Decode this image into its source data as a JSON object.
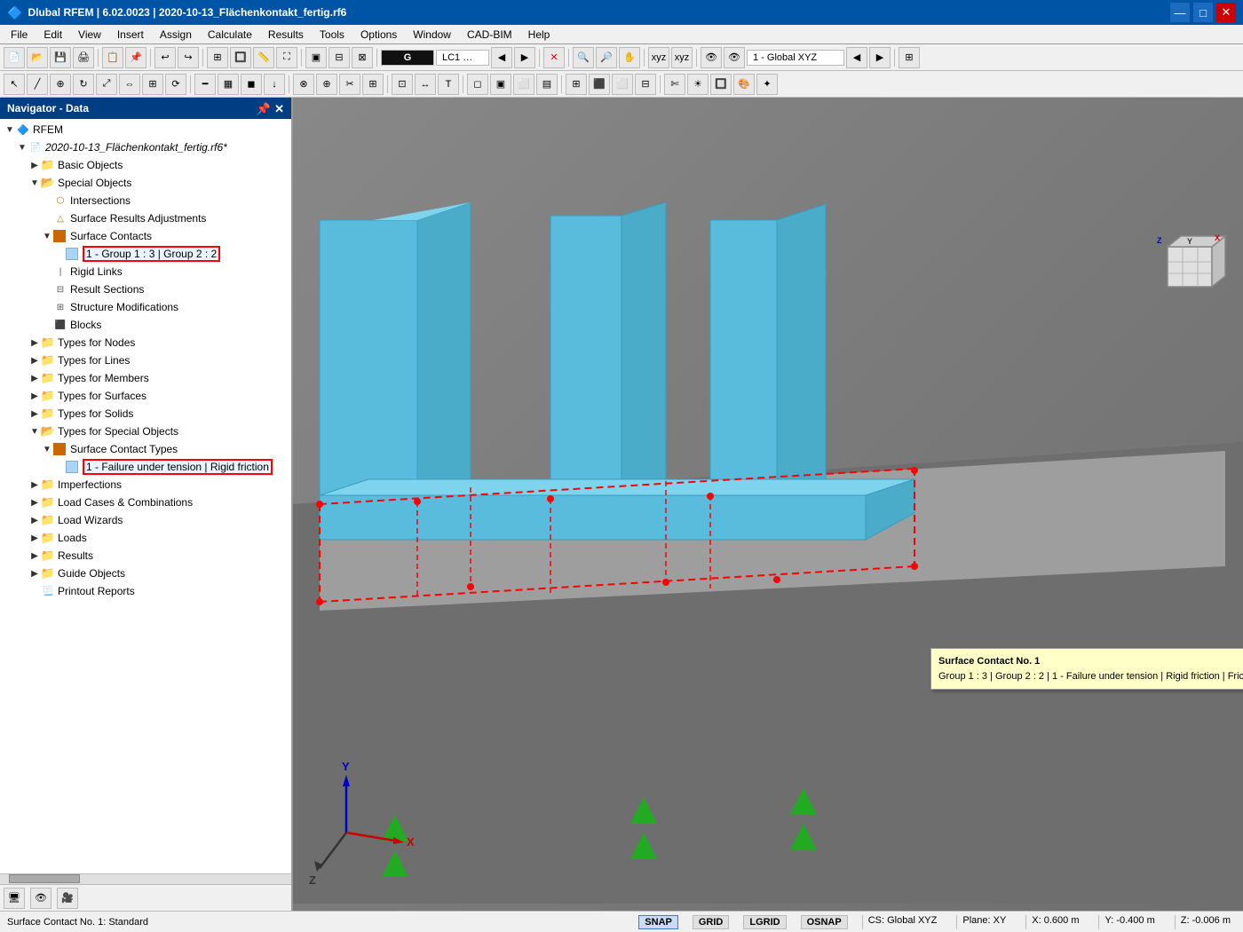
{
  "titlebar": {
    "title": "Dlubal RFEM | 6.02.0023 | 2020-10-13_Flächenkontakt_fertig.rf6",
    "min": "—",
    "max": "□",
    "close": "✕"
  },
  "menubar": {
    "items": [
      "File",
      "Edit",
      "View",
      "Insert",
      "Assign",
      "Calculate",
      "Results",
      "Tools",
      "Options",
      "Window",
      "CAD-BIM",
      "Help"
    ]
  },
  "navigator": {
    "title": "Navigator - Data",
    "rfem_label": "RFEM",
    "file_label": "2020-10-13_Flächenkontakt_fertig.rf6*",
    "tree": [
      {
        "id": "basic-objects",
        "label": "Basic Objects",
        "level": 1,
        "type": "folder",
        "expanded": false
      },
      {
        "id": "special-objects",
        "label": "Special Objects",
        "level": 1,
        "type": "folder",
        "expanded": true
      },
      {
        "id": "intersections",
        "label": "Intersections",
        "level": 2,
        "type": "item-special"
      },
      {
        "id": "surface-results-adj",
        "label": "Surface Results Adjustments",
        "level": 2,
        "type": "item-special"
      },
      {
        "id": "surface-contacts",
        "label": "Surface Contacts",
        "level": 2,
        "type": "item-orange",
        "expanded": true
      },
      {
        "id": "surface-contact-1",
        "label": "1 - Group 1 : 3 | Group 2 : 2",
        "level": 3,
        "type": "item-highlight-red"
      },
      {
        "id": "rigid-links",
        "label": "Rigid Links",
        "level": 2,
        "type": "item"
      },
      {
        "id": "result-sections",
        "label": "Result Sections",
        "level": 2,
        "type": "item"
      },
      {
        "id": "structure-modifications",
        "label": "Structure Modifications",
        "level": 2,
        "type": "item"
      },
      {
        "id": "blocks",
        "label": "Blocks",
        "level": 2,
        "type": "item"
      },
      {
        "id": "types-nodes",
        "label": "Types for Nodes",
        "level": 1,
        "type": "folder",
        "expanded": false
      },
      {
        "id": "types-lines",
        "label": "Types for Lines",
        "level": 1,
        "type": "folder",
        "expanded": false
      },
      {
        "id": "types-members",
        "label": "Types for Members",
        "level": 1,
        "type": "folder",
        "expanded": false
      },
      {
        "id": "types-surfaces",
        "label": "Types for Surfaces",
        "level": 1,
        "type": "folder",
        "expanded": false
      },
      {
        "id": "types-solids",
        "label": "Types for Solids",
        "level": 1,
        "type": "folder",
        "expanded": false
      },
      {
        "id": "types-special-objects",
        "label": "Types for Special Objects",
        "level": 1,
        "type": "folder",
        "expanded": true
      },
      {
        "id": "surface-contact-types",
        "label": "Surface Contact Types",
        "level": 2,
        "type": "item-orange",
        "expanded": true
      },
      {
        "id": "sct-1",
        "label": "1 - Failure under tension | Rigid friction",
        "level": 3,
        "type": "item-highlight-red"
      },
      {
        "id": "imperfections",
        "label": "Imperfections",
        "level": 1,
        "type": "folder",
        "expanded": false
      },
      {
        "id": "load-cases",
        "label": "Load Cases & Combinations",
        "level": 1,
        "type": "folder",
        "expanded": false
      },
      {
        "id": "load-wizards",
        "label": "Load Wizards",
        "level": 1,
        "type": "folder",
        "expanded": false
      },
      {
        "id": "loads",
        "label": "Loads",
        "level": 1,
        "type": "folder",
        "expanded": false
      },
      {
        "id": "results",
        "label": "Results",
        "level": 1,
        "type": "folder",
        "expanded": false
      },
      {
        "id": "guide-objects",
        "label": "Guide Objects",
        "level": 1,
        "type": "folder",
        "expanded": false
      },
      {
        "id": "printout-reports",
        "label": "Printout Reports",
        "level": 1,
        "type": "item"
      }
    ]
  },
  "viewport": {
    "tooltip": {
      "line1": "Surface Contact No. 1",
      "line2": "Group 1 : 3 | Group 2 : 2 | 1 - Failure under tension | Rigid friction | Friction coefficient"
    }
  },
  "statusbar": {
    "left": "Surface Contact No. 1: Standard",
    "snap": "SNAP",
    "grid": "GRID",
    "lgrid": "LGRID",
    "osnap": "OSNAP",
    "cs": "CS: Global XYZ",
    "plane": "Plane: XY",
    "x": "X: 0.600 m",
    "y": "Y: -0.400 m",
    "z": "Z: -0.006 m"
  }
}
